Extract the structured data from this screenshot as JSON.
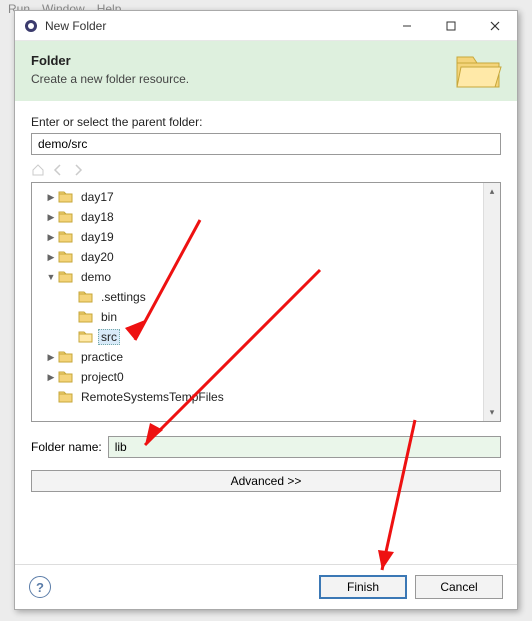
{
  "bg_menu": [
    "Run",
    "Window",
    "Help"
  ],
  "titlebar": {
    "title": "New Folder"
  },
  "banner": {
    "heading": "Folder",
    "sub": "Create a new folder resource."
  },
  "parent_label": "Enter or select the parent folder:",
  "parent_value": "demo/src",
  "tree": [
    {
      "label": "day17",
      "ind": 1,
      "exp": "▶",
      "sel": false
    },
    {
      "label": "day18",
      "ind": 1,
      "exp": "▶",
      "sel": false
    },
    {
      "label": "day19",
      "ind": 1,
      "exp": "▶",
      "sel": false
    },
    {
      "label": "day20",
      "ind": 1,
      "exp": "▶",
      "sel": false
    },
    {
      "label": "demo",
      "ind": 1,
      "exp": "▼",
      "sel": false
    },
    {
      "label": ".settings",
      "ind": 2,
      "exp": "",
      "sel": false
    },
    {
      "label": "bin",
      "ind": 2,
      "exp": "",
      "sel": false
    },
    {
      "label": "src",
      "ind": 2,
      "exp": "",
      "sel": true
    },
    {
      "label": "practice",
      "ind": 1,
      "exp": "▶",
      "sel": false
    },
    {
      "label": "project0",
      "ind": 1,
      "exp": "▶",
      "sel": false
    },
    {
      "label": "RemoteSystemsTempFiles",
      "ind": 1,
      "exp": "",
      "sel": false
    }
  ],
  "folder_name_label": "Folder name:",
  "folder_name_value": "lib",
  "advanced_label": "Advanced >>",
  "buttons": {
    "finish": "Finish",
    "cancel": "Cancel"
  },
  "help_glyph": "?"
}
